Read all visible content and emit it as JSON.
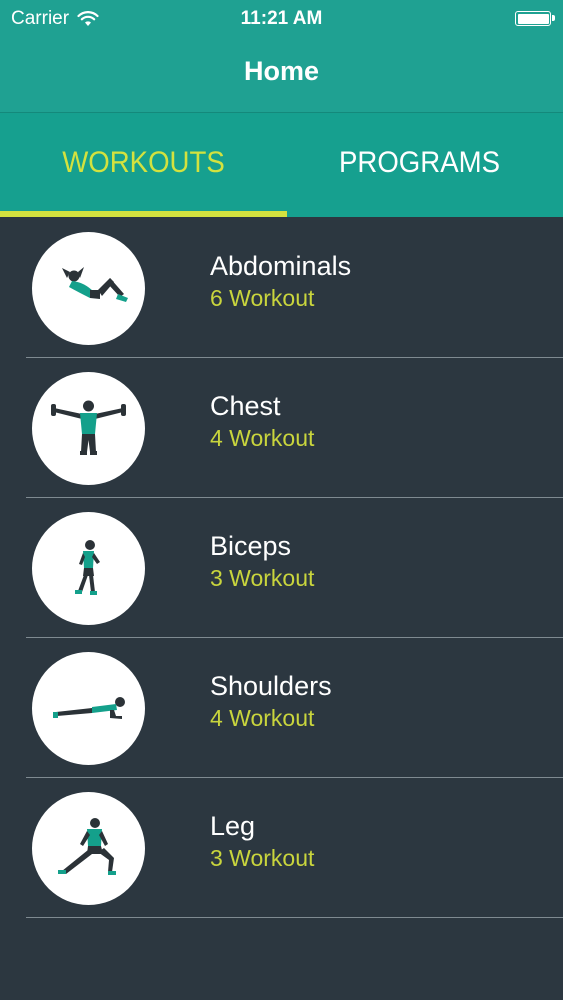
{
  "status": {
    "carrier": "Carrier",
    "time": "11:21 AM",
    "icons": [
      "wifi-icon",
      "battery-icon"
    ]
  },
  "nav": {
    "title": "Home"
  },
  "tabs": [
    {
      "label": "WORKOUTS",
      "selected": true
    },
    {
      "label": "PROGRAMS",
      "selected": false
    }
  ],
  "workouts": [
    {
      "name": "Abdominals",
      "count": "6 Workout",
      "icon": "crunch-figure-icon"
    },
    {
      "name": "Chest",
      "count": "4 Workout",
      "icon": "arms-stretch-figure-icon"
    },
    {
      "name": "Biceps",
      "count": "3 Workout",
      "icon": "walking-figure-icon"
    },
    {
      "name": "Shoulders",
      "count": "4 Workout",
      "icon": "plank-figure-icon"
    },
    {
      "name": "Leg",
      "count": "3 Workout",
      "icon": "lunge-figure-icon"
    }
  ],
  "colors": {
    "header": "#1fa192",
    "tab_bar": "#16a08f",
    "accent": "#d3e23f",
    "background": "#2c3740",
    "figure_shirt": "#14a08b",
    "figure_body": "#2b3237"
  }
}
